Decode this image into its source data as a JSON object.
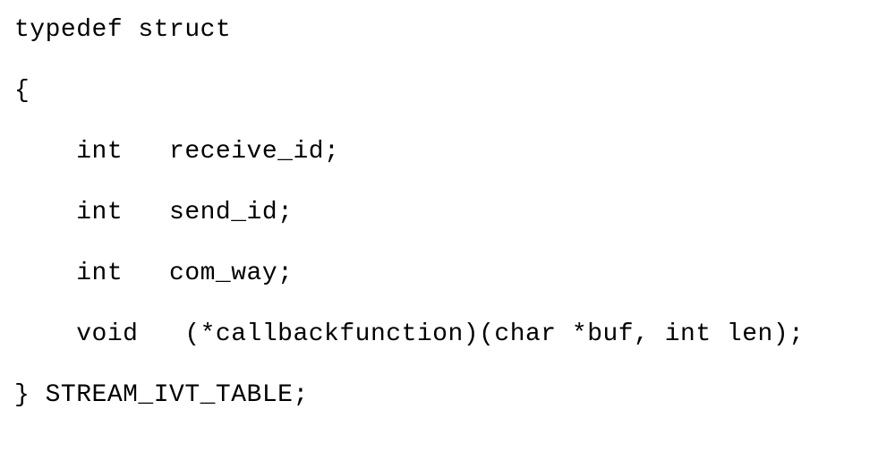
{
  "code": {
    "line1": "typedef struct",
    "line2": "{",
    "line3": "    int   receive_id;",
    "line4": "    int   send_id;",
    "line5": "    int   com_way;",
    "line6": "    void   (*callbackfunction)(char *buf, int len);",
    "line7": "} STREAM_IVT_TABLE;"
  }
}
